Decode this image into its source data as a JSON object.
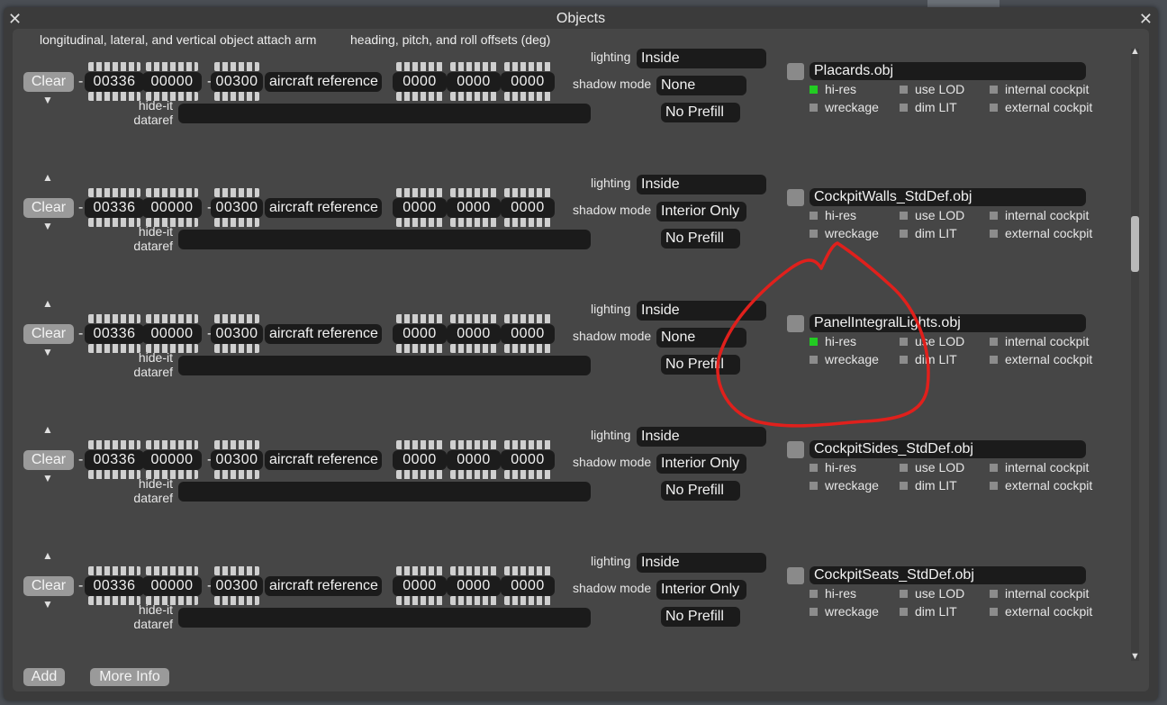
{
  "window": {
    "title": "Objects"
  },
  "headers": {
    "arm": "longitudinal, lateral, and vertical object attach arm",
    "offsets": "heading, pitch, and roll offsets (deg)"
  },
  "labels": {
    "clear": "Clear",
    "minus": "-",
    "lighting": "lighting",
    "shadow_mode": "shadow mode",
    "hide_it": "hide-it",
    "dataref": "dataref",
    "opt_hires": "hi-res",
    "opt_uselod": "use LOD",
    "opt_internal": "internal cockpit",
    "opt_wreckage": "wreckage",
    "opt_dimlit": "dim LIT",
    "opt_external": "external cockpit"
  },
  "rows": [
    {
      "long": "00336",
      "lat": "00000",
      "vert": "00300",
      "reference": "aircraft reference",
      "heading": "0000",
      "pitch": "0000",
      "roll": "0000",
      "lighting": "Inside",
      "shadow": "None",
      "prefill": "No Prefill",
      "hide_dataref": "",
      "object": "Placards.obj",
      "hires": true,
      "uselod": false,
      "internal": false,
      "wreckage": false,
      "dimlit": false,
      "external": false
    },
    {
      "long": "00336",
      "lat": "00000",
      "vert": "00300",
      "reference": "aircraft reference",
      "heading": "0000",
      "pitch": "0000",
      "roll": "0000",
      "lighting": "Inside",
      "shadow": "Interior Only",
      "prefill": "No Prefill",
      "hide_dataref": "",
      "object": "CockpitWalls_StdDef.obj",
      "hires": false,
      "uselod": false,
      "internal": false,
      "wreckage": false,
      "dimlit": false,
      "external": false
    },
    {
      "long": "00336",
      "lat": "00000",
      "vert": "00300",
      "reference": "aircraft reference",
      "heading": "0000",
      "pitch": "0000",
      "roll": "0000",
      "lighting": "Inside",
      "shadow": "None",
      "prefill": "No Prefill",
      "hide_dataref": "",
      "object": "PanelIntegralLights.obj",
      "hires": true,
      "uselod": false,
      "internal": false,
      "wreckage": false,
      "dimlit": false,
      "external": false
    },
    {
      "long": "00336",
      "lat": "00000",
      "vert": "00300",
      "reference": "aircraft reference",
      "heading": "0000",
      "pitch": "0000",
      "roll": "0000",
      "lighting": "Inside",
      "shadow": "Interior Only",
      "prefill": "No Prefill",
      "hide_dataref": "",
      "object": "CockpitSides_StdDef.obj",
      "hires": false,
      "uselod": false,
      "internal": false,
      "wreckage": false,
      "dimlit": false,
      "external": false
    },
    {
      "long": "00336",
      "lat": "00000",
      "vert": "00300",
      "reference": "aircraft reference",
      "heading": "0000",
      "pitch": "0000",
      "roll": "0000",
      "lighting": "Inside",
      "shadow": "Interior Only",
      "prefill": "No Prefill",
      "hide_dataref": "",
      "object": "CockpitSeats_StdDef.obj",
      "hires": false,
      "uselod": false,
      "internal": false,
      "wreckage": false,
      "dimlit": false,
      "external": false
    }
  ],
  "footer": {
    "add": "Add",
    "more_info": "More Info"
  },
  "colors": {
    "checked": "#22cc22",
    "unchecked": "#8c8c8c",
    "annotation": "#e0201c"
  },
  "icons": {
    "close": "close-icon",
    "up": "arrow-up-icon",
    "down": "arrow-down-icon"
  }
}
